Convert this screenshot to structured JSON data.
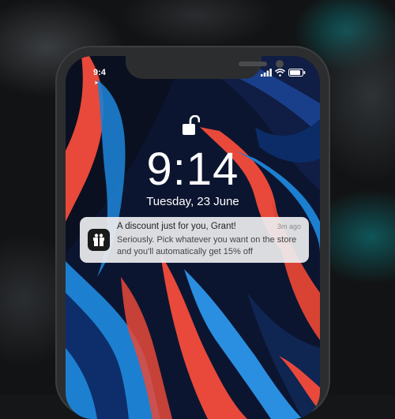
{
  "status_bar": {
    "time": "9:4",
    "location_icon": "location-arrow-icon",
    "signal_icon": "signal-bars-icon",
    "wifi_icon": "wifi-icon",
    "battery_icon": "battery-icon"
  },
  "lock_screen": {
    "lock_icon": "unlocked-padlock-icon",
    "time": "9:14",
    "date": "Tuesday, 23 June"
  },
  "notification": {
    "app_icon": "gift-box-icon",
    "title": "A discount just for you, Grant!",
    "time_ago": "3m ago",
    "body": "Seriously. Pick whatever you want on the store and you'll automatically get 15% off"
  },
  "colors": {
    "wallpaper_red": "#e8493a",
    "wallpaper_blue": "#1d7fd0",
    "wallpaper_navy": "#0f1f4a",
    "phone_frame": "#2c2d2f"
  }
}
